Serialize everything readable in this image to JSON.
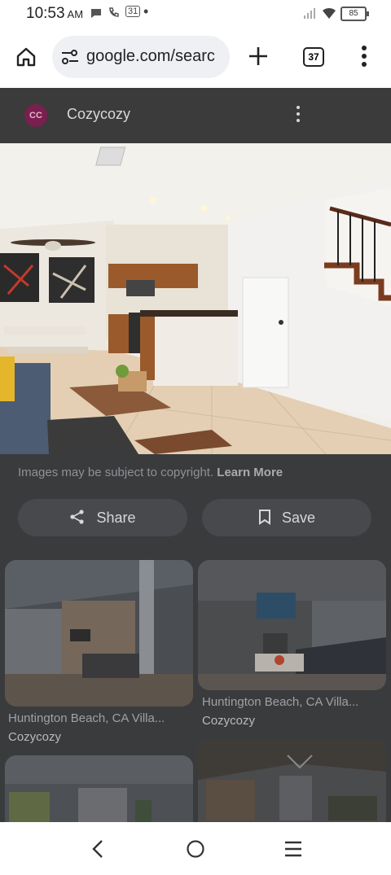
{
  "status_bar": {
    "time": "10:53",
    "ampm": "AM",
    "calendar_day": "31",
    "battery": "85",
    "icons": [
      "chat-icon",
      "phone-wifi-icon",
      "calendar-icon",
      "dot-icon",
      "signal-icon",
      "wifi-icon",
      "battery-icon"
    ]
  },
  "browser": {
    "url": "google.com/searc",
    "tab_count": "37"
  },
  "viewer": {
    "site_initials": "CC",
    "site_name": "Cozycozy",
    "copyright_text": "Images may be subject to copyright.",
    "learn_more": "Learn More",
    "share_label": "Share",
    "save_label": "Save"
  },
  "related": [
    {
      "title": "Huntington Beach, CA Villa...",
      "source": "Cozycozy"
    },
    {
      "title": "Huntington Beach, CA Villa...",
      "source": "Cozycozy"
    },
    {
      "title": "",
      "source": ""
    },
    {
      "title": "",
      "source": ""
    }
  ]
}
